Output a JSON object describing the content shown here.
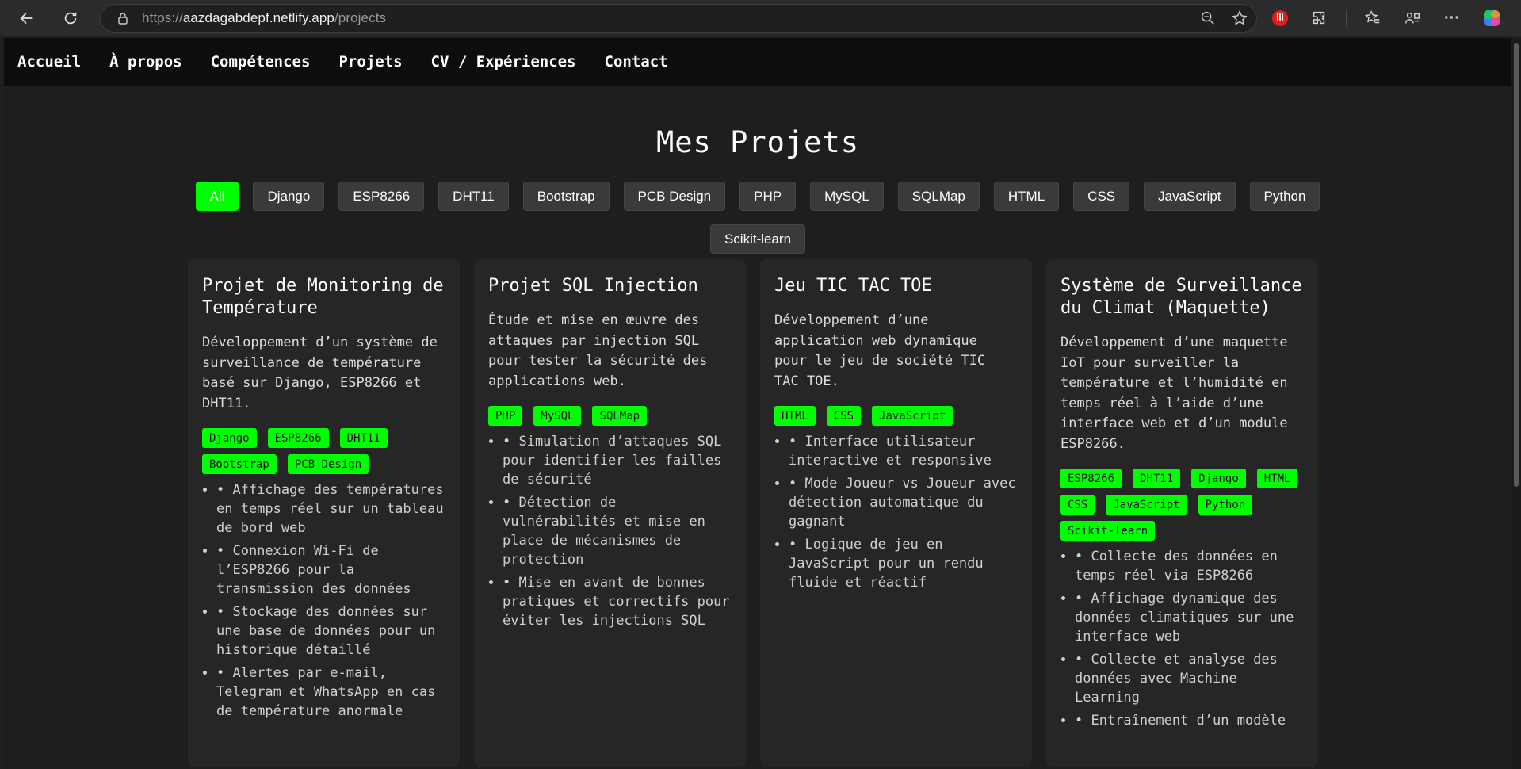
{
  "browser": {
    "url_prefix": "https://",
    "url_host": "aazdagabdepf.netlify.app",
    "url_path": "/projects"
  },
  "nav": [
    "Accueil",
    "À propos",
    "Compétences",
    "Projets",
    "CV / Expériences",
    "Contact"
  ],
  "page_title": "Mes Projets",
  "filters": [
    "All",
    "Django",
    "ESP8266",
    "DHT11",
    "Bootstrap",
    "PCB Design",
    "PHP",
    "MySQL",
    "SQLMap",
    "HTML",
    "CSS",
    "JavaScript",
    "Python",
    "Scikit-learn"
  ],
  "active_filter": "All",
  "accent_color": "#00ff00",
  "projects": [
    {
      "title": "Projet de Monitoring de Température",
      "description": "Développement d’un système de surveillance de température basé sur Django, ESP8266 et DHT11.",
      "tags": [
        "Django",
        "ESP8266",
        "DHT11",
        "Bootstrap",
        "PCB Design"
      ],
      "features": [
        "• Affichage des températures en temps réel sur un tableau de bord web",
        "• Connexion Wi-Fi de l’ESP8266 pour la transmission des données",
        "• Stockage des données sur une base de données pour un historique détaillé",
        "• Alertes par e-mail, Telegram et WhatsApp en cas de température anormale"
      ]
    },
    {
      "title": "Projet SQL Injection",
      "description": "Étude et mise en œuvre des attaques par injection SQL pour tester la sécurité des applications web.",
      "tags": [
        "PHP",
        "MySQL",
        "SQLMap"
      ],
      "features": [
        "• Simulation d’attaques SQL pour identifier les failles de sécurité",
        "• Détection de vulnérabilités et mise en place de mécanismes de protection",
        "• Mise en avant de bonnes pratiques et correctifs pour éviter les injections SQL"
      ]
    },
    {
      "title": "Jeu TIC TAC TOE",
      "description": "Développement d’une application web dynamique pour le jeu de société TIC TAC TOE.",
      "tags": [
        "HTML",
        "CSS",
        "JavaScript"
      ],
      "features": [
        "• Interface utilisateur interactive et responsive",
        "• Mode Joueur vs Joueur avec détection automatique du gagnant",
        "• Logique de jeu en JavaScript pour un rendu fluide et réactif"
      ]
    },
    {
      "title": "Système de Surveillance du Climat (Maquette)",
      "description": "Développement d’une maquette IoT pour surveiller la température et l’humidité en temps réel à l’aide d’une interface web et d’un module ESP8266.",
      "tags": [
        "ESP8266",
        "DHT11",
        "Django",
        "HTML",
        "CSS",
        "JavaScript",
        "Python",
        "Scikit-learn"
      ],
      "features": [
        "• Collecte des données en temps réel via ESP8266",
        "• Affichage dynamique des données climatiques sur une interface web",
        "• Collecte et analyse des données avec Machine Learning",
        "• Entraînement d’un modèle"
      ]
    }
  ]
}
